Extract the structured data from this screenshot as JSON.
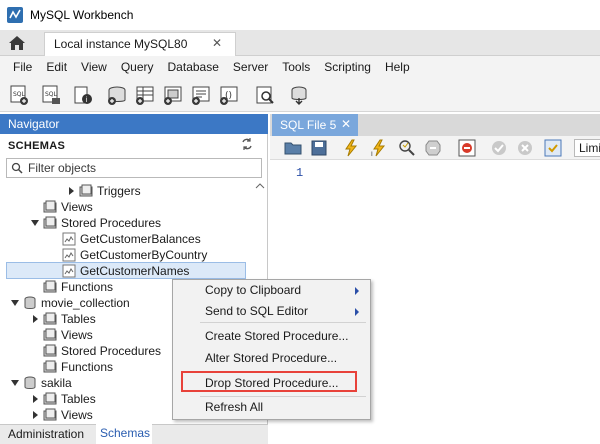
{
  "window": {
    "title": "MySQL Workbench"
  },
  "tabs": {
    "connection_label": "Local instance MySQL80",
    "close_glyph": "✕"
  },
  "menubar": {
    "items": [
      "File",
      "Edit",
      "View",
      "Query",
      "Database",
      "Server",
      "Tools",
      "Scripting",
      "Help"
    ]
  },
  "navigator": {
    "header": "Navigator",
    "schemas_title": "SCHEMAS",
    "filter_placeholder": "Filter objects",
    "tree": [
      {
        "label": "Triggers"
      },
      {
        "label": "Views"
      },
      {
        "label": "Stored Procedures"
      },
      {
        "label": "GetCustomerBalances"
      },
      {
        "label": "GetCustomerByCountry"
      },
      {
        "label": "GetCustomerNames"
      },
      {
        "label": "Functions"
      },
      {
        "label": "movie_collection"
      },
      {
        "label": "Tables"
      },
      {
        "label": "Views"
      },
      {
        "label": "Stored Procedures"
      },
      {
        "label": "Functions"
      },
      {
        "label": "sakila"
      },
      {
        "label": "Tables"
      },
      {
        "label": "Views"
      }
    ],
    "bottom_tabs": {
      "administration": "Administration",
      "schemas": "Schemas"
    }
  },
  "editor": {
    "tab_label": "SQL File 5",
    "tab_close": "✕",
    "line_number": "1",
    "limit_label": "Limit"
  },
  "context_menu": {
    "items": [
      {
        "label": "Copy to Clipboard"
      },
      {
        "label": "Send to SQL Editor"
      },
      {
        "label": "Create Stored Procedure..."
      },
      {
        "label": "Alter Stored Procedure..."
      },
      {
        "label": "Drop Stored Procedure..."
      },
      {
        "label": "Refresh All"
      }
    ],
    "highlighted": "Drop Stored Procedure..."
  },
  "colors": {
    "accent": "#3c78c5",
    "highlight": "#e8423a",
    "selection": "#dce9f8"
  }
}
